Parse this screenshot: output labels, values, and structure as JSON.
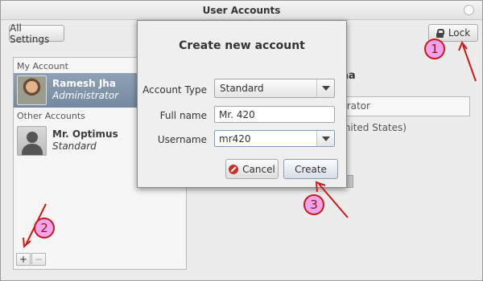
{
  "window": {
    "title": "User Accounts"
  },
  "toolbar": {
    "all_settings_label": "All Settings",
    "lock_label": "Lock"
  },
  "user_panel": {
    "my_account_label": "My Account",
    "other_accounts_label": "Other Accounts",
    "users": [
      {
        "name": "Ramesh Jha",
        "role": "Administrator",
        "avatar": "photo",
        "selected": true
      },
      {
        "name": "Mr. Optimus",
        "role": "Standard",
        "avatar": "generic-person-icon",
        "selected": false
      }
    ],
    "add_button": "+",
    "remove_button": "−"
  },
  "details": {
    "name_fragment": "h Jha",
    "account_type_fragment": "trator",
    "language_fragment": "United States)"
  },
  "dialog": {
    "title": "Create new account",
    "account_type_label": "Account Type",
    "account_type_value": "Standard",
    "full_name_label": "Full name",
    "full_name_value": "Mr. 420",
    "username_label": "Username",
    "username_value": "mr420",
    "cancel_label": "Cancel",
    "create_label": "Create"
  },
  "annotations": [
    {
      "number": "1",
      "color": "#d01818"
    },
    {
      "number": "2",
      "color": "#d01818"
    },
    {
      "number": "3",
      "color": "#d01818"
    }
  ],
  "colors": {
    "selection": "#8194ab",
    "callout_fill": "#ee96f0",
    "callout_stroke": "#d01818"
  }
}
